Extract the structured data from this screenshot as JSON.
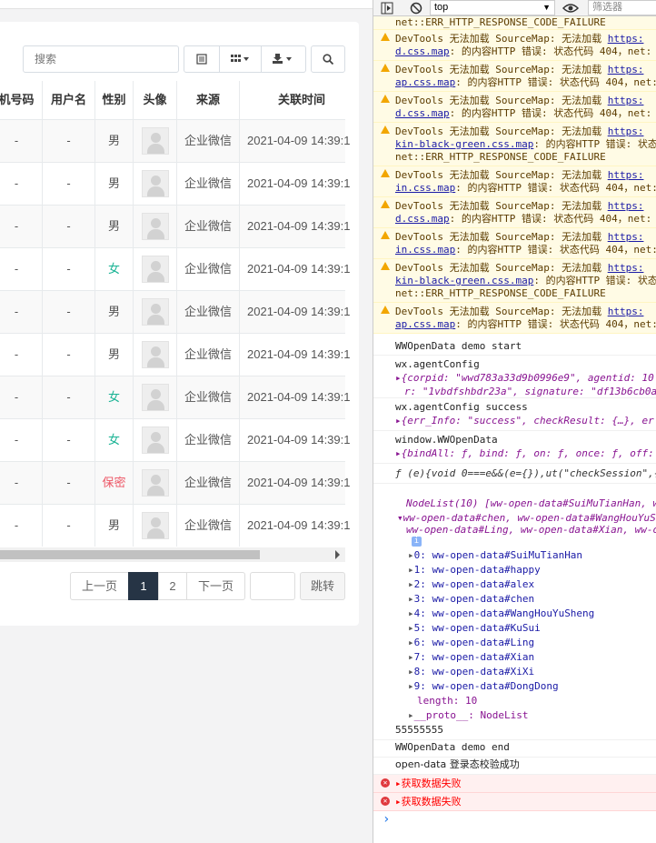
{
  "toolbar": {
    "search_placeholder": "搜索"
  },
  "table": {
    "headers": [
      "机号码",
      "用户名",
      "性别",
      "头像",
      "来源",
      "关联时间"
    ],
    "rows": [
      {
        "phone": "-",
        "user": "-",
        "gender": "男",
        "gclass": "",
        "source": "企业微信",
        "time": "2021-04-09 14:39:1"
      },
      {
        "phone": "-",
        "user": "-",
        "gender": "男",
        "gclass": "",
        "source": "企业微信",
        "time": "2021-04-09 14:39:1"
      },
      {
        "phone": "-",
        "user": "-",
        "gender": "男",
        "gclass": "",
        "source": "企业微信",
        "time": "2021-04-09 14:39:1"
      },
      {
        "phone": "-",
        "user": "-",
        "gender": "女",
        "gclass": "female",
        "source": "企业微信",
        "time": "2021-04-09 14:39:1"
      },
      {
        "phone": "-",
        "user": "-",
        "gender": "男",
        "gclass": "",
        "source": "企业微信",
        "time": "2021-04-09 14:39:1"
      },
      {
        "phone": "-",
        "user": "-",
        "gender": "男",
        "gclass": "",
        "source": "企业微信",
        "time": "2021-04-09 14:39:1"
      },
      {
        "phone": "-",
        "user": "-",
        "gender": "女",
        "gclass": "female",
        "source": "企业微信",
        "time": "2021-04-09 14:39:1"
      },
      {
        "phone": "-",
        "user": "-",
        "gender": "女",
        "gclass": "female",
        "source": "企业微信",
        "time": "2021-04-09 14:39:1"
      },
      {
        "phone": "-",
        "user": "-",
        "gender": "保密",
        "gclass": "secret",
        "source": "企业微信",
        "time": "2021-04-09 14:39:1"
      },
      {
        "phone": "-",
        "user": "-",
        "gender": "男",
        "gclass": "",
        "source": "企业微信",
        "time": "2021-04-09 14:39:1"
      }
    ]
  },
  "pagination": {
    "prev": "上一页",
    "page1": "1",
    "page2": "2",
    "next": "下一页",
    "jump": "跳转"
  },
  "devtools": {
    "context": "top",
    "filter": "筛选器",
    "warn_top": "net::ERR_HTTP_RESPONSE_CODE_FAILURE",
    "warnings": [
      {
        "l1": "DevTools 无法加载 SourceMap: 无法加载 ",
        "link": "https:",
        "l2a": "d.css.map",
        "l2b": ": 的内容HTTP 错误: 状态代码 404，net:",
        "l3": ""
      },
      {
        "l1": "DevTools 无法加载 SourceMap: 无法加载 ",
        "link": "https:",
        "l2a": "ap.css.map",
        "l2b": ": 的内容HTTP 错误: 状态代码 404，net:",
        "l3": ""
      },
      {
        "l1": "DevTools 无法加载 SourceMap: 无法加载 ",
        "link": "https:",
        "l2a": "d.css.map",
        "l2b": ": 的内容HTTP 错误: 状态代码 404，net:",
        "l3": ""
      },
      {
        "l1": "DevTools 无法加载 SourceMap: 无法加载 ",
        "link": "https:",
        "l2a": "kin-black-green.css.map",
        "l2b": ": 的内容HTTP 错误: 状态",
        "l3": "net::ERR_HTTP_RESPONSE_CODE_FAILURE"
      },
      {
        "l1": "DevTools 无法加载 SourceMap: 无法加载 ",
        "link": "https:",
        "l2a": "in.css.map",
        "l2b": ": 的内容HTTP 错误: 状态代码 404，net:",
        "l3": ""
      },
      {
        "l1": "DevTools 无法加载 SourceMap: 无法加载 ",
        "link": "https:",
        "l2a": "d.css.map",
        "l2b": ": 的内容HTTP 错误: 状态代码 404，net:",
        "l3": ""
      },
      {
        "l1": "DevTools 无法加载 SourceMap: 无法加载 ",
        "link": "https:",
        "l2a": "in.css.map",
        "l2b": ": 的内容HTTP 错误: 状态代码 404，net:",
        "l3": ""
      },
      {
        "l1": "DevTools 无法加载 SourceMap: 无法加载 ",
        "link": "https:",
        "l2a": "kin-black-green.css.map",
        "l2b": ": 的内容HTTP 错误: 状态",
        "l3": "net::ERR_HTTP_RESPONSE_CODE_FAILURE"
      },
      {
        "l1": "DevTools 无法加载 SourceMap: 无法加载 ",
        "link": "https:",
        "l2a": "ap.css.map",
        "l2b": ": 的内容HTTP 错误: 状态代码 404，net:",
        "l3": ""
      }
    ],
    "log_start": "WWOpenData demo start",
    "agent_config": "wx.agentConfig",
    "agent_obj": "{corpid: \"wwd783a33d9b0996e9\", agentid: 10",
    "agent_obj2": "r: \"1vbdfshbdr23a\", signature: \"df13b6cb0a",
    "agent_success": "wx.agentConfig success",
    "success_obj": "{err_Info: \"success\", checkResult: {…}, er",
    "wwopen": "window.WWOpenData",
    "wwopen_obj": "{bindAll: ƒ, bind: ƒ, on: ƒ, once: ƒ, off:",
    "fn_line": "ƒ (e){void 0===e&&(e={}),ut(\"checkSession\",{",
    "nodelist_head": "NodeList(10) [ww-open-data#SuiMuTianHan, w",
    "nodelist_l2": "ww-open-data#chen, ww-open-data#WangHouYuS",
    "nodelist_l3": "ww-open-data#Ling, ww-open-data#Xian, ww-o",
    "nodes": [
      "0: ww-open-data#SuiMuTianHan",
      "1: ww-open-data#happy",
      "2: ww-open-data#alex",
      "3: ww-open-data#chen",
      "4: ww-open-data#WangHouYuSheng",
      "5: ww-open-data#KuSui",
      "6: ww-open-data#Ling",
      "7: ww-open-data#Xian",
      "8: ww-open-data#XiXi",
      "9: ww-open-data#DongDong"
    ],
    "length": "length: 10",
    "proto": "__proto__: NodeList",
    "num": "55555555",
    "log_end": "WWOpenData demo end",
    "open_ok": "open-data 登录态校验成功",
    "err1": "▸获取数据失败",
    "err2": "▸获取数据失败",
    "prompt": "›"
  }
}
